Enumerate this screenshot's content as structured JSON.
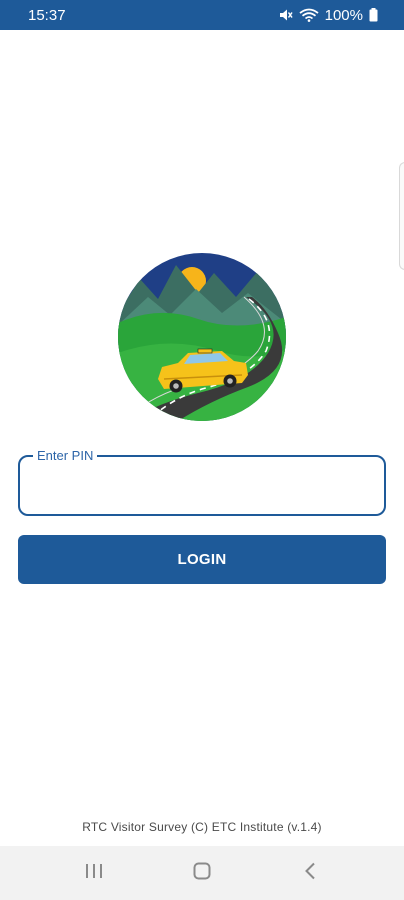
{
  "status_bar": {
    "time": "15:37",
    "battery": "100%",
    "icons": [
      "mute-icon",
      "wifi-icon",
      "battery-icon"
    ],
    "background_color": "#1e5a99"
  },
  "login_form": {
    "pin_label": "Enter PIN",
    "pin_value": "",
    "login_label": "LOGIN",
    "accent_color": "#1e5a99"
  },
  "footer": {
    "text": "RTC Visitor Survey (C) ETC Institute (v.1.4)"
  },
  "nav_bar": {
    "icons": [
      "recent-apps-icon",
      "home-icon",
      "back-icon"
    ]
  }
}
